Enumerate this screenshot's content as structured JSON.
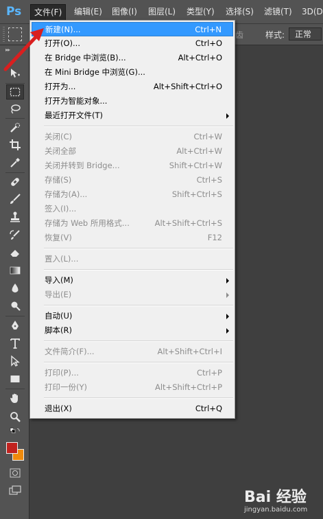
{
  "app": {
    "logo_text": "Ps"
  },
  "menubar": {
    "items": [
      "文件(F)",
      "编辑(E)",
      "图像(I)",
      "图层(L)",
      "类型(Y)",
      "选择(S)",
      "滤镜(T)",
      "3D(D"
    ],
    "active_index": 0
  },
  "options_bar": {
    "feather_tail": "齿",
    "style_label": "样式:",
    "style_value": "正常"
  },
  "toolbox": {
    "tools": [
      "move-tool",
      "marquee-tool",
      "lasso-tool",
      "quick-selection-tool",
      "crop-tool",
      "eyedropper-tool",
      "healing-brush-tool",
      "brush-tool",
      "clone-stamp-tool",
      "history-brush-tool",
      "eraser-tool",
      "gradient-tool",
      "blur-tool",
      "dodge-tool",
      "pen-tool",
      "type-tool",
      "path-selection-tool",
      "rectangle-tool",
      "hand-tool",
      "zoom-tool"
    ],
    "selected": "marquee-tool",
    "foreground_color": "#c0221f",
    "background_color": "#ef8a0c"
  },
  "file_menu": {
    "groups": [
      [
        {
          "label": "新建(N)...",
          "shortcut": "Ctrl+N",
          "highlight": true
        },
        {
          "label": "打开(O)...",
          "shortcut": "Ctrl+O"
        },
        {
          "label": "在 Bridge 中浏览(B)...",
          "shortcut": "Alt+Ctrl+O"
        },
        {
          "label": "在 Mini Bridge 中浏览(G)...",
          "shortcut": ""
        },
        {
          "label": "打开为...",
          "shortcut": "Alt+Shift+Ctrl+O"
        },
        {
          "label": "打开为智能对象...",
          "shortcut": ""
        },
        {
          "label": "最近打开文件(T)",
          "shortcut": "",
          "submenu": true
        }
      ],
      [
        {
          "label": "关闭(C)",
          "shortcut": "Ctrl+W",
          "disabled": true
        },
        {
          "label": "关闭全部",
          "shortcut": "Alt+Ctrl+W",
          "disabled": true
        },
        {
          "label": "关闭并转到 Bridge...",
          "shortcut": "Shift+Ctrl+W",
          "disabled": true
        },
        {
          "label": "存储(S)",
          "shortcut": "Ctrl+S",
          "disabled": true
        },
        {
          "label": "存储为(A)...",
          "shortcut": "Shift+Ctrl+S",
          "disabled": true
        },
        {
          "label": "签入(I)...",
          "shortcut": "",
          "disabled": true
        },
        {
          "label": "存储为 Web 所用格式...",
          "shortcut": "Alt+Shift+Ctrl+S",
          "disabled": true
        },
        {
          "label": "恢复(V)",
          "shortcut": "F12",
          "disabled": true
        }
      ],
      [
        {
          "label": "置入(L)...",
          "shortcut": "",
          "disabled": true
        }
      ],
      [
        {
          "label": "导入(M)",
          "shortcut": "",
          "submenu": true
        },
        {
          "label": "导出(E)",
          "shortcut": "",
          "submenu": true,
          "disabled": true
        }
      ],
      [
        {
          "label": "自动(U)",
          "shortcut": "",
          "submenu": true
        },
        {
          "label": "脚本(R)",
          "shortcut": "",
          "submenu": true
        }
      ],
      [
        {
          "label": "文件简介(F)...",
          "shortcut": "Alt+Shift+Ctrl+I",
          "disabled": true
        }
      ],
      [
        {
          "label": "打印(P)...",
          "shortcut": "Ctrl+P",
          "disabled": true
        },
        {
          "label": "打印一份(Y)",
          "shortcut": "Alt+Shift+Ctrl+P",
          "disabled": true
        }
      ],
      [
        {
          "label": "退出(X)",
          "shortcut": "Ctrl+Q"
        }
      ]
    ]
  },
  "watermark": {
    "logo_text": "Bai 经验",
    "url": "jingyan.baidu.com"
  },
  "colors": {
    "highlight": "#3399ff",
    "annotation": "#d91f1f",
    "ps_logo": "#5ab7ff"
  }
}
